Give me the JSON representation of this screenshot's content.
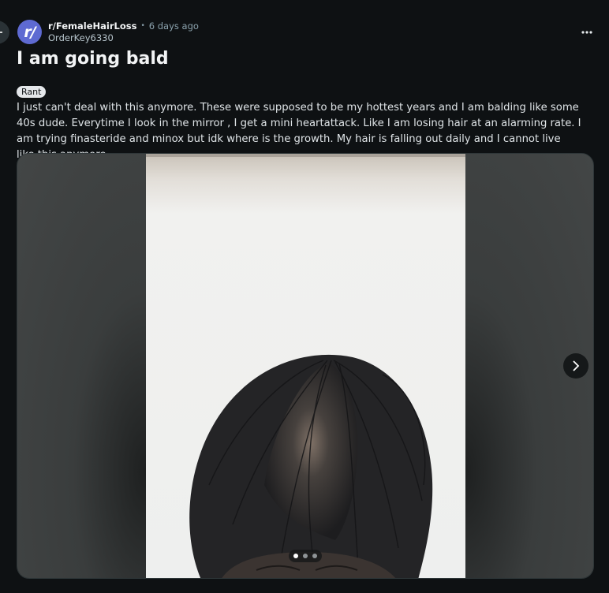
{
  "post": {
    "subreddit": "r/FemaleHairLoss",
    "separator": "•",
    "time_ago": "6 days ago",
    "author": "OrderKey6330",
    "avatar_text": "r/",
    "title": "I am going bald",
    "flair": "Rant",
    "body": "I just can't deal with this anymore. These were supposed to be my hottest years and I am balding like some 40s dude. Everytime I look in the mirror , I get a mini heartattack. Like I am losing hair at an alarming rate. I am trying finasteride and minox but idk where is the growth. My hair is falling out daily and I cannot live like this anymore."
  },
  "gallery": {
    "image_count": 3,
    "active_index": 0
  },
  "icons": {
    "back": "arrow-left-icon",
    "overflow": "more-horizontal-icon",
    "next": "chevron-right-icon"
  },
  "colors": {
    "background": "#0e1113",
    "avatar": "#5e6ad2",
    "flair_bg": "#e4e7ea"
  }
}
